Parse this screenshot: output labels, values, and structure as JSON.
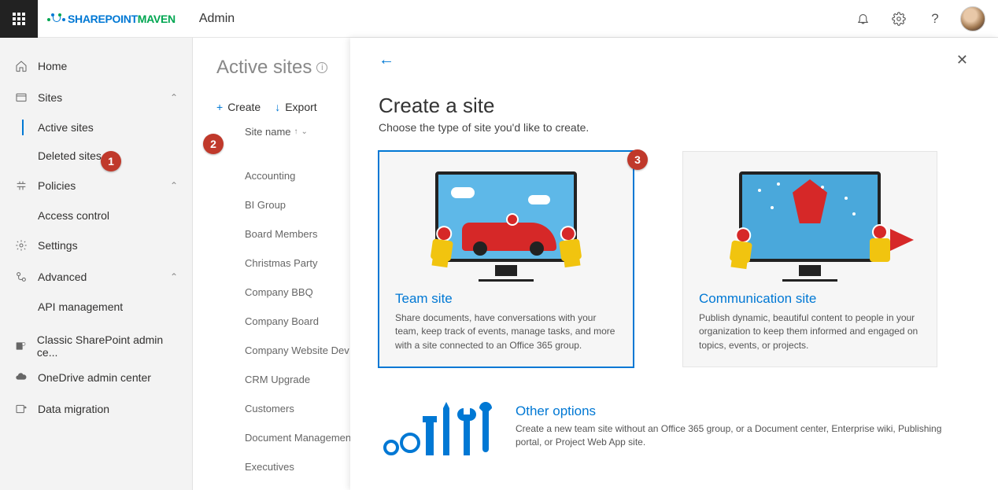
{
  "topbar": {
    "logo_part1": "SHAREPOINT",
    "logo_part2": "MAVEN",
    "app_name": "Admin"
  },
  "sidebar": {
    "home": "Home",
    "sites": "Sites",
    "sites_children": {
      "active": "Active sites",
      "deleted": "Deleted sites"
    },
    "policies": "Policies",
    "policies_children": {
      "access": "Access control"
    },
    "settings": "Settings",
    "advanced": "Advanced",
    "advanced_children": {
      "api": "API management"
    },
    "classic": "Classic SharePoint admin ce...",
    "onedrive": "OneDrive admin center",
    "migration": "Data migration"
  },
  "list": {
    "title": "Active sites",
    "create": "Create",
    "export": "Export",
    "col_name": "Site name",
    "rows": [
      "Accounting",
      "BI Group",
      "Board Members",
      "Christmas Party",
      "Company BBQ",
      "Company Board",
      "Company Website Dev",
      "CRM Upgrade",
      "Customers",
      "Document Management",
      "Executives"
    ]
  },
  "panel": {
    "title": "Create a site",
    "subtitle": "Choose the type of site you'd like to create.",
    "team": {
      "title": "Team site",
      "desc": "Share documents, have conversations with your team, keep track of events, manage tasks, and more with a site connected to an Office 365 group."
    },
    "comm": {
      "title": "Communication site",
      "desc": "Publish dynamic, beautiful content to people in your organization to keep them informed and engaged on topics, events, or projects."
    },
    "other": {
      "title": "Other options",
      "desc": "Create a new team site without an Office 365 group, or a Document center, Enterprise wiki, Publishing portal, or Project Web App site."
    }
  },
  "badges": {
    "b1": "1",
    "b2": "2",
    "b3": "3"
  }
}
